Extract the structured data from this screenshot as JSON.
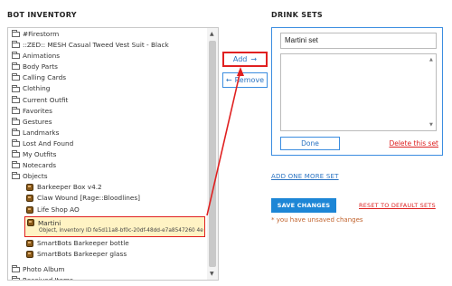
{
  "inventory": {
    "heading": "BOT INVENTORY",
    "items": [
      {
        "label": "#Firestorm",
        "kind": "folder"
      },
      {
        "label": "::ZED:: MESH Casual Tweed Vest Suit - Black",
        "kind": "folder"
      },
      {
        "label": "Animations",
        "kind": "folder"
      },
      {
        "label": "Body Parts",
        "kind": "folder"
      },
      {
        "label": "Calling Cards",
        "kind": "folder"
      },
      {
        "label": "Clothing",
        "kind": "folder"
      },
      {
        "label": "Current Outfit",
        "kind": "folder"
      },
      {
        "label": "Favorites",
        "kind": "folder"
      },
      {
        "label": "Gestures",
        "kind": "folder"
      },
      {
        "label": "Landmarks",
        "kind": "folder"
      },
      {
        "label": "Lost And Found",
        "kind": "folder"
      },
      {
        "label": "My Outfits",
        "kind": "folder"
      },
      {
        "label": "Notecards",
        "kind": "folder"
      },
      {
        "label": "Objects",
        "kind": "folder"
      },
      {
        "label": "Barkeeper Box v4.2",
        "kind": "object"
      },
      {
        "label": "Claw Wound [Rage::Bloodlines]",
        "kind": "object"
      },
      {
        "label": "Life Shop AO",
        "kind": "object"
      },
      {
        "label": "Martini",
        "kind": "object-selected",
        "sublabel": "Object, inventory ID fe5d11a8-bf0c-20df-48dd-e7a8547260 4e"
      },
      {
        "label": "SmartBots Barkeeper bottle",
        "kind": "object"
      },
      {
        "label": "SmartBots Barkeeper glass",
        "kind": "object"
      },
      {
        "label": "",
        "kind": "spacer"
      },
      {
        "label": "Photo Album",
        "kind": "folder"
      },
      {
        "label": "Received Items",
        "kind": "folder"
      }
    ]
  },
  "transfer": {
    "add_label": "Add",
    "add_arrow": "→",
    "remove_arrow": "←",
    "remove_label": "Remove"
  },
  "drink_sets": {
    "heading": "DRINK SETS",
    "set_name": "Martini set",
    "done_label": "Done",
    "delete_label": "Delete this set",
    "add_more_label": "ADD ONE MORE SET"
  },
  "actions": {
    "save_label": "SAVE CHANGES",
    "reset_label": "RESET TO DEFAULT SETS",
    "unsaved_notice": "* you have unsaved changes"
  },
  "colors": {
    "accent": "#1d86d6",
    "annotation_red": "#e02020",
    "selected_bg": "#fff3c4",
    "warning_text": "#c0622c"
  }
}
